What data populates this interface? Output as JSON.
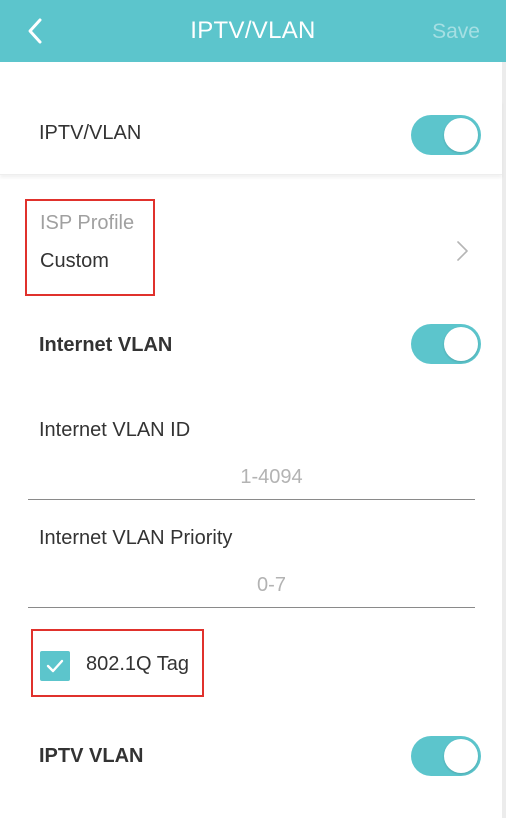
{
  "header": {
    "title": "IPTV/VLAN",
    "save_label": "Save",
    "back_icon": "chevron-left-icon",
    "background_color": "#5cc5cc"
  },
  "iptv_vlan": {
    "label": "IPTV/VLAN",
    "enabled": true
  },
  "isp_profile": {
    "label": "ISP Profile",
    "value": "Custom",
    "icon": "chevron-right-icon"
  },
  "internet_vlan": {
    "label": "Internet VLAN",
    "enabled": true,
    "id_label": "Internet VLAN ID",
    "id_value": "",
    "id_placeholder": "1-4094",
    "priority_label": "Internet VLAN Priority",
    "priority_value": "",
    "priority_placeholder": "0-7",
    "tag_label": "802.1Q Tag",
    "tag_checked": true
  },
  "iptv_vlan_section": {
    "label": "IPTV VLAN",
    "enabled": true
  },
  "colors": {
    "accent": "#5cc5cc",
    "highlight_box": "#e0312c"
  }
}
